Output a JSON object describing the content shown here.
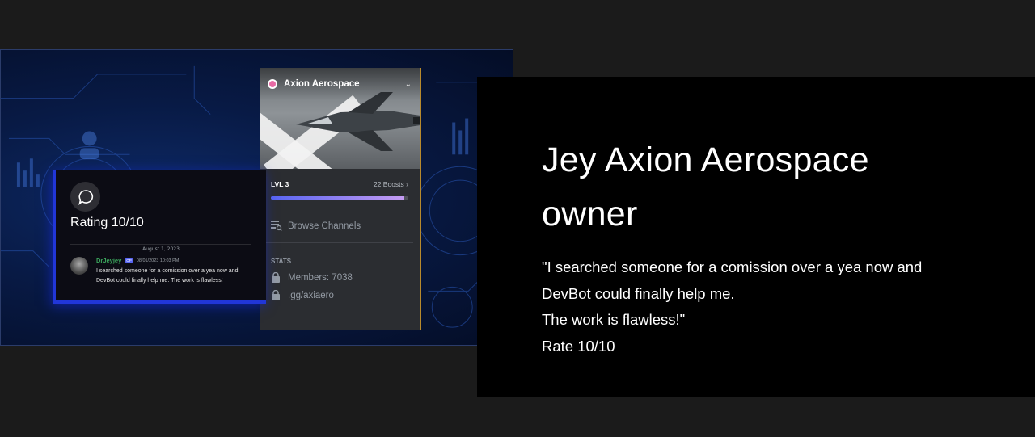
{
  "server": {
    "name": "Axion Aerospace",
    "level": "LVL 3",
    "boosts": "22 Boosts",
    "boost_progress": 0.97,
    "browse": "Browse Channels",
    "stats_heading": "STATS",
    "members": "Members: 7038",
    "invite": ".gg/axiaero"
  },
  "card": {
    "title": "Rating 10/10",
    "date": "August 1, 2023",
    "user": "DrJeyjey",
    "tag": "OP",
    "timestamp": "08/01/2023 10:03 PM",
    "message": "I searched someone for a comission over a yea now and DevBot could finally help me. The work is flawless!"
  },
  "testimonial": {
    "headline_line1": "Jey Axion Aerospace",
    "headline_line2": "owner",
    "quote_line1": "\"I searched someone for a comission over a yea now and",
    "quote_line2": "DevBot could finally help me.",
    "quote_line3": "The work is flawless!\"",
    "rate": "Rate 10/10"
  },
  "colors": {
    "background": "#1b1b1b",
    "panel": "#000000",
    "accent_blue": "#2136d8",
    "discord_sidebar": "#2b2d31",
    "username_green": "#3ba55c"
  }
}
